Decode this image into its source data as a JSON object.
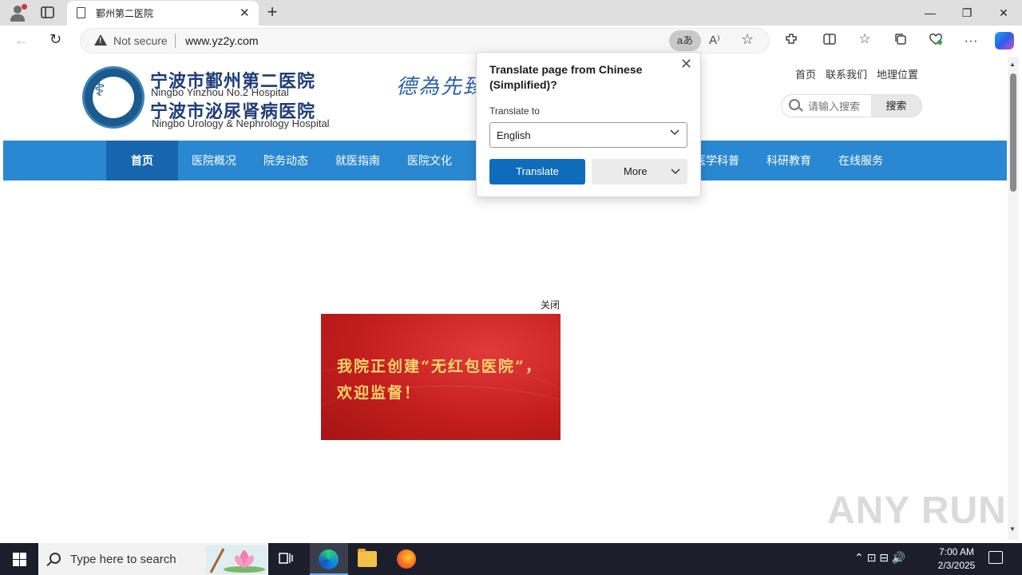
{
  "browser": {
    "tab_title": "鄞州第二医院",
    "tab_close": "✕",
    "new_tab": "+",
    "window_controls": {
      "minimize": "—",
      "maximize": "❐",
      "close": "✕"
    },
    "not_secure_label": "Not secure",
    "url": "www.yz2y.com",
    "translate_icon_label": "aあ",
    "read_aloud_icon": "A⁾",
    "favorite_icon": "☆",
    "icons": [
      "profile-icon",
      "tab-actions-icon",
      "back-icon",
      "reload-icon",
      "warning-icon",
      "translate-icon",
      "read-aloud-icon",
      "favorite-icon",
      "extensions-icon",
      "split-screen-icon",
      "favorites-icon",
      "collections-icon",
      "browser-essentials-icon",
      "more-icon",
      "copilot-icon"
    ],
    "toolbar_glyphs": {
      "back": "←",
      "reload": "↻",
      "extensions": "⬚",
      "split": "◫",
      "favorites": "☆",
      "collections": "⧉",
      "essentials": "♡",
      "more": "···"
    }
  },
  "site": {
    "name_cn_1": "宁波市鄞州第二医院",
    "name_en_1": "Ningbo Yinzhou No.2 Hospital",
    "name_cn_2": "宁波市泌尿肾病医院",
    "name_en_2": "Ningbo Urology & Nephrology Hospital",
    "calligraphy": "德為先臻",
    "top_links": [
      "首页",
      "联系我们",
      "地理位置"
    ],
    "search_placeholder": "请输入搜索",
    "search_button": "搜索",
    "nav": [
      "首页",
      "医院概况",
      "院务动态",
      "就医指南",
      "医院文化",
      "医学科普",
      "科研教育",
      "在线服务"
    ],
    "nav_active_index": 0,
    "popup_close_label": "关闭",
    "banner_text": "我院正创建“无红包医院”，欢迎监督！",
    "watermark": "ANY RUN"
  },
  "translate_popup": {
    "title": "Translate page from Chinese (Simplified)?",
    "translate_to_label": "Translate to",
    "selected_language": "English",
    "translate_button": "Translate",
    "more_button": "More",
    "close_icon": "✕",
    "chevron": "⌄"
  },
  "taskbar": {
    "search_placeholder": "Type here to search",
    "time": "7:00 AM",
    "date": "2/3/2025",
    "tray_glyphs": "⌃  ⊡  ⊟  🔊"
  },
  "colors": {
    "nav_blue": "#2a88d2",
    "nav_active": "#1766ad",
    "translate_blue": "#0f6cbd",
    "banner_red": "#c31d1d",
    "banner_text": "#f6d46b"
  }
}
